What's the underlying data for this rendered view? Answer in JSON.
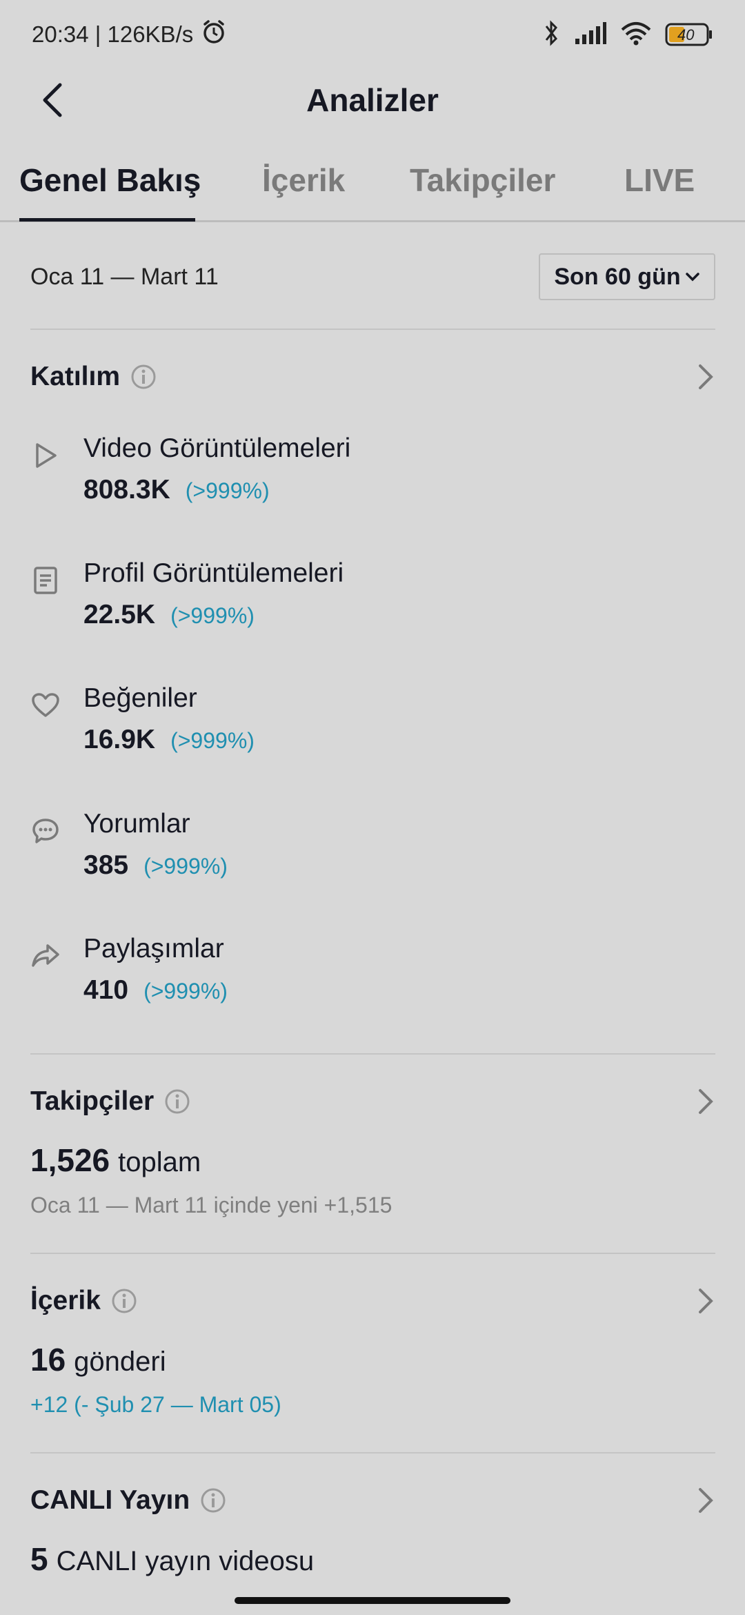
{
  "status_bar": {
    "time_speed": "20:34 | 126KB/s",
    "battery": "40"
  },
  "header": {
    "title": "Analizler"
  },
  "tabs": [
    {
      "label": "Genel Bakış",
      "active": true
    },
    {
      "label": "İçerik",
      "active": false
    },
    {
      "label": "Takipçiler",
      "active": false
    },
    {
      "label": "LIVE",
      "active": false
    }
  ],
  "date_range": {
    "label": "Oca 11 — Mart 11",
    "select_value": "Son 60 gün"
  },
  "engagement": {
    "title": "Katılım",
    "metrics": [
      {
        "icon": "play-icon",
        "label": "Video Görüntülemeleri",
        "value": "808.3K",
        "change": "(>999%)"
      },
      {
        "icon": "profile-doc-icon",
        "label": "Profil Görüntülemeleri",
        "value": "22.5K",
        "change": "(>999%)"
      },
      {
        "icon": "heart-icon",
        "label": "Beğeniler",
        "value": "16.9K",
        "change": "(>999%)"
      },
      {
        "icon": "comment-icon",
        "label": "Yorumlar",
        "value": "385",
        "change": "(>999%)"
      },
      {
        "icon": "share-icon",
        "label": "Paylaşımlar",
        "value": "410",
        "change": "(>999%)"
      }
    ]
  },
  "followers": {
    "title": "Takipçiler",
    "total": "1,526",
    "total_unit": "toplam",
    "sub": "Oca 11 — Mart 11 içinde yeni +1,515"
  },
  "content": {
    "title": "İçerik",
    "total": "16",
    "total_unit": "gönderi",
    "sub": "+12 (- Şub 27 — Mart 05)"
  },
  "live": {
    "title": "CANLI Yayın",
    "total": "5",
    "total_unit": "CANLI yayın videosu"
  },
  "colors": {
    "background": "#d8d8d8",
    "accent_blue": "#1f8fb0",
    "text_primary": "#161823",
    "text_secondary": "#7f7f7f"
  }
}
